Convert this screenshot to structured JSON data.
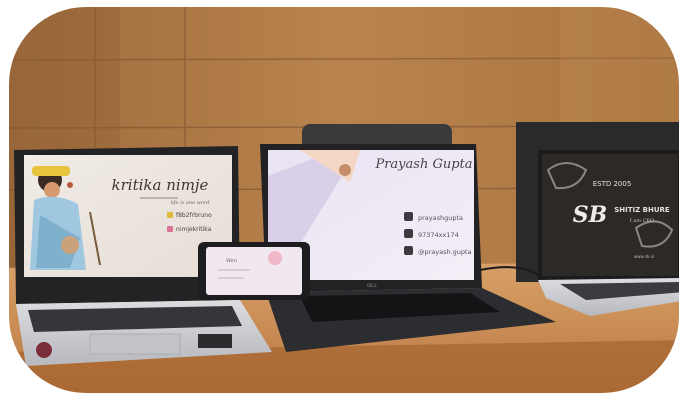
{
  "scene": {
    "description_colors": {
      "wall": "#b07a45",
      "desk": "#c9894e",
      "laptop_dark": "#2b2b2e",
      "laptop_silver": "#c9cbd0"
    }
  },
  "laptop_left": {
    "name": "kritika nimje",
    "tagline": "life is one word",
    "instagram": "f8b2frbruno",
    "handle": "nimjekritika"
  },
  "laptop_center": {
    "name": "Prayash Gupta",
    "facebook": "prayashgupta",
    "phone": "97374xx174",
    "instagram": "@prayash.gupta",
    "brand": "DELL"
  },
  "phone": {
    "text": "Wen"
  },
  "laptop_right": {
    "estd": "ESTD 2005",
    "monogram": "SB",
    "name": "SHITIZ BHURE",
    "role": "I am CEO",
    "url": "www.sb.in"
  }
}
